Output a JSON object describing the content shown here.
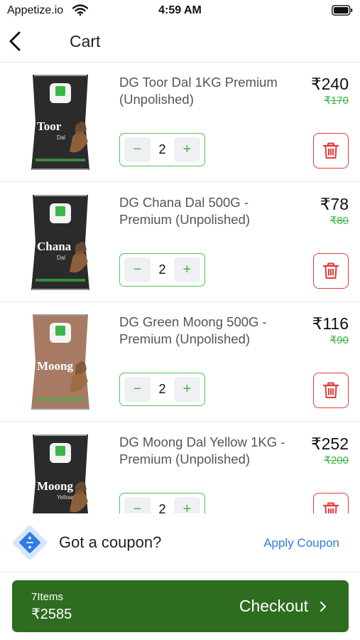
{
  "status_bar": {
    "carrier": "Appetize.io",
    "time": "4:59 AM"
  },
  "header": {
    "title": "Cart"
  },
  "cart": {
    "items": [
      {
        "name": "DG Toor Dal 1KG Premium (Unpolished)",
        "price": "₹240",
        "mrp": "₹170",
        "quantity": "2",
        "pack_label": "Toor",
        "pack_sub": "Dal",
        "pack_color": "#2b2b2b"
      },
      {
        "name": "DG Chana Dal 500G - Premium (Unpolished)",
        "price": "₹78",
        "mrp": "₹80",
        "quantity": "2",
        "pack_label": "Chana",
        "pack_sub": "Dal",
        "pack_color": "#2b2b2b"
      },
      {
        "name": "DG Green Moong 500G - Premium (Unpolished)",
        "price": "₹116",
        "mrp": "₹90",
        "quantity": "2",
        "pack_label": "Moong",
        "pack_sub": "",
        "pack_color": "#a77a64"
      },
      {
        "name": "DG Moong Dal Yellow 1KG - Premium (Unpolished)",
        "price": "₹252",
        "mrp": "₹200",
        "quantity": "2",
        "pack_label": "Moong",
        "pack_sub": "Yellow",
        "pack_color": "#2b2b2b"
      }
    ],
    "minus_symbol": "−",
    "plus_symbol": "+"
  },
  "coupon": {
    "text": "Got a coupon?",
    "action": "Apply Coupon"
  },
  "checkout": {
    "items_count": "7Items",
    "total": "₹2585",
    "label": "Checkout"
  },
  "colors": {
    "accent_green": "#3cb54a",
    "checkout_green": "#2e6d1f",
    "delete_red": "#e23b3b",
    "link_blue": "#2e7ce0"
  },
  "icons": {
    "back": "chevron-left-icon",
    "delete": "trash-icon",
    "coupon": "coupon-tag-icon",
    "checkout": "chevron-right-icon"
  }
}
